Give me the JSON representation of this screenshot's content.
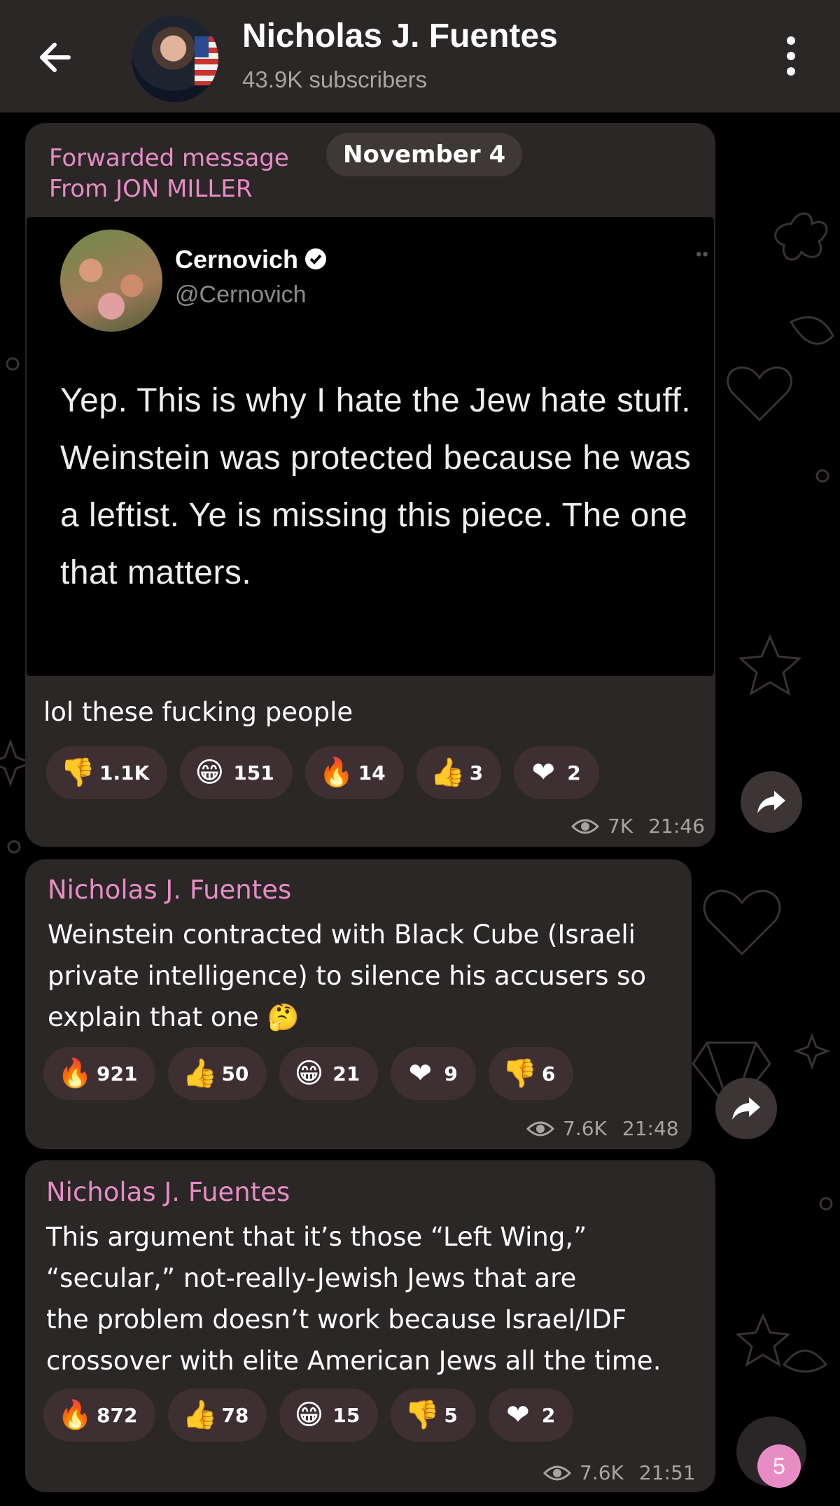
{
  "header": {
    "title": "Nicholas J. Fuentes",
    "subscribers": "43.9K subscribers"
  },
  "messages": [
    {
      "forwarded": "Forwarded message",
      "from_prefix": "From",
      "from_name": "JON MILLER",
      "date_pill": "November 4",
      "tweet": {
        "name": "Cernovich",
        "handle": "@Cernovich",
        "text": "Yep. This is why I hate the Jew hate stuff. Weinstein was protected because he was a leftist. Ye is missing this piece. The one that matters."
      },
      "caption": "lol these fucking people",
      "reactions": [
        {
          "icon": "thumbs-down",
          "emoji": "👎",
          "count": "1.1K"
        },
        {
          "icon": "grinning-face",
          "emoji": "😁",
          "count": "151"
        },
        {
          "icon": "fire",
          "emoji": "🔥",
          "count": "14"
        },
        {
          "icon": "thumbs-up",
          "emoji": "👍",
          "count": "3"
        },
        {
          "icon": "heart",
          "emoji": "❤",
          "count": "2"
        }
      ],
      "views": "7K",
      "time": "21:46"
    },
    {
      "sender": "Nicholas J. Fuentes",
      "text_lines": [
        "Weinstein contracted with Black Cube (Israeli",
        "private intelligence) to silence his accusers so",
        "explain that one"
      ],
      "trailing_emoji": "🤔",
      "reactions": [
        {
          "icon": "fire",
          "emoji": "🔥",
          "count": "921"
        },
        {
          "icon": "thumbs-up",
          "emoji": "👍",
          "count": "50"
        },
        {
          "icon": "grinning-face",
          "emoji": "😁",
          "count": "21"
        },
        {
          "icon": "heart",
          "emoji": "❤",
          "count": "9"
        },
        {
          "icon": "thumbs-down",
          "emoji": "👎",
          "count": "6"
        }
      ],
      "views": "7.6K",
      "time": "21:48"
    },
    {
      "sender": "Nicholas J. Fuentes",
      "text_lines": [
        "This argument that it’s those “Left Wing,”",
        "“secular,” not-really-Jewish Jews that are",
        "the problem doesn’t work because Israel/IDF",
        "crossover with elite American Jews all the time."
      ],
      "reactions": [
        {
          "icon": "fire",
          "emoji": "🔥",
          "count": "872"
        },
        {
          "icon": "thumbs-up",
          "emoji": "👍",
          "count": "78"
        },
        {
          "icon": "grinning-face",
          "emoji": "😁",
          "count": "15"
        },
        {
          "icon": "thumbs-down",
          "emoji": "👎",
          "count": "5"
        },
        {
          "icon": "heart",
          "emoji": "❤",
          "count": "2"
        }
      ],
      "views": "7.6K",
      "time": "21:51"
    }
  ],
  "unread_badge": "5",
  "colors": {
    "accent_pink": "#e88cc6",
    "bubble": "#2a2726",
    "chip": "#3e2f33",
    "header": "#2b2727"
  }
}
